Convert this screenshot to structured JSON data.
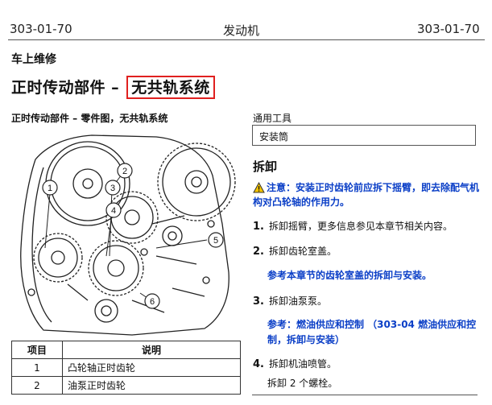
{
  "header": {
    "left": "303-01-70",
    "center": "发动机",
    "right": "303-01-70"
  },
  "section": "车上维修",
  "title": {
    "main": "正时传动部件 – ",
    "highlight": "无共轨系统"
  },
  "figure_title": "正时传动部件 – 零件图，无共轨系统",
  "callouts": [
    "1",
    "2",
    "3",
    "4",
    "5",
    "6"
  ],
  "parts_table": {
    "headers": [
      "项目",
      "说明"
    ],
    "rows": [
      {
        "item": "1",
        "desc": "凸轮轴正时齿轮"
      },
      {
        "item": "2",
        "desc": "油泵正时齿轮"
      }
    ]
  },
  "tools": {
    "label": "通用工具",
    "item": "安装筒"
  },
  "removal": {
    "heading": "拆卸",
    "caution": "注意：安装正时齿轮前应拆下摇臂，即去除配气机构对凸轮轴的作用力。",
    "steps": [
      {
        "n": "1.",
        "text": "拆卸摇臂，更多信息参见本章节相关内容。"
      },
      {
        "n": "2.",
        "text": "拆卸齿轮室盖。",
        "ref": "参考本章节的齿轮室盖的拆卸与安装。"
      },
      {
        "n": "3.",
        "text": "拆卸油泵泵。",
        "ref": "参考：燃油供应和控制 （303-04 燃油供应和控制，拆卸与安装）"
      },
      {
        "n": "4.",
        "text": "拆卸机油喷管。",
        "sub": "拆卸 2 个螺栓。"
      }
    ]
  },
  "colors": {
    "highlight_box": "#e0201f",
    "link_blue": "#0b3fc7",
    "warning_yellow": "#f5c400"
  },
  "icons": {
    "caution": "warning-triangle-icon"
  }
}
